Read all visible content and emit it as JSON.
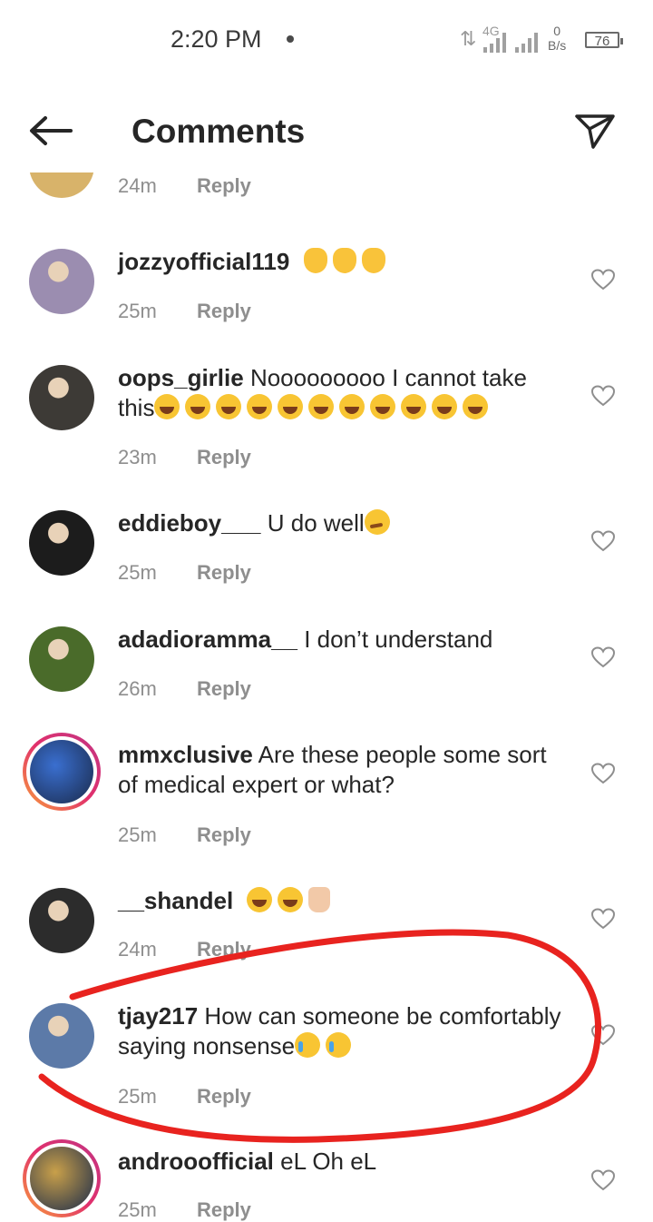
{
  "status_bar": {
    "time": "2:20 PM",
    "network": "4G",
    "speed_value": "0",
    "speed_unit": "B/s",
    "battery": "76"
  },
  "header": {
    "title": "Comments",
    "back_icon": "arrow-left-icon",
    "share_icon": "paper-plane-icon"
  },
  "partial_top": {
    "time": "24m",
    "reply": "Reply"
  },
  "comments": [
    {
      "username": "jozzyofficial119",
      "text": "",
      "emojis": [
        "clap",
        "clap",
        "clap"
      ],
      "time": "25m",
      "reply": "Reply",
      "avatar_color": "#9b8db0"
    },
    {
      "username": "oops_girlie",
      "text": "Nooooooooo I cannot take this",
      "emojis": [
        "laugh",
        "laugh",
        "laugh",
        "laugh",
        "laugh",
        "laugh",
        "laugh",
        "laugh",
        "laugh",
        "laugh",
        "laugh"
      ],
      "time": "23m",
      "reply": "Reply",
      "avatar_color": "#3d3a36"
    },
    {
      "username": "eddieboy___",
      "text": "U do well",
      "emojis": [
        "dizzy"
      ],
      "time": "25m",
      "reply": "Reply",
      "avatar_color": "#1c1c1c"
    },
    {
      "username": "adadioramma__",
      "text": "I don’t understand",
      "emojis": [],
      "time": "26m",
      "reply": "Reply",
      "avatar_color": "#4a6b2a"
    },
    {
      "username": "mmxclusive",
      "text": "Are these people some sort of medical expert or what?",
      "emojis": [],
      "time": "25m",
      "reply": "Reply",
      "avatar_color": "#3a6fd0"
    },
    {
      "username": "__shandel",
      "text": "",
      "emojis": [
        "laugh",
        "laugh",
        "pray"
      ],
      "time": "24m",
      "reply": "Reply",
      "avatar_color": "#2c2c2c"
    },
    {
      "username": "tjay217",
      "text": "How can someone be comfortably saying nonsense",
      "emojis": [
        "cry",
        "cry"
      ],
      "time": "25m",
      "reply": "Reply",
      "avatar_color": "#5c7aa8"
    },
    {
      "username": "androoofficial",
      "text": "eL Oh eL",
      "emojis": [],
      "time": "25m",
      "reply": "Reply",
      "avatar_color": "#c9a04a"
    }
  ],
  "colors": {
    "text": "#262626",
    "meta": "#8e8e8e",
    "annotation": "#e8231f"
  }
}
